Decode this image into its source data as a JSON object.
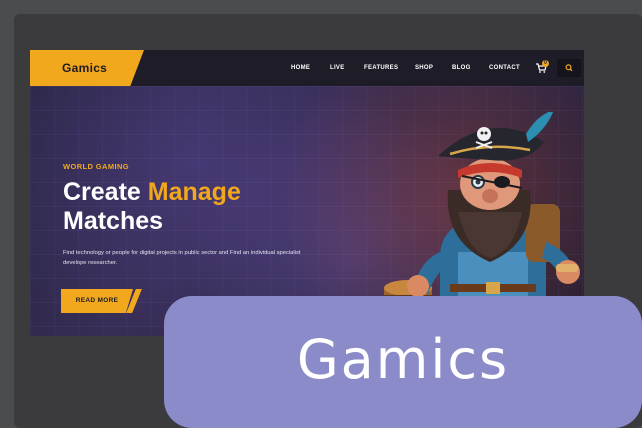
{
  "brand": {
    "name": "Gamics",
    "accent": "#f2a81d"
  },
  "nav": {
    "items": [
      "HOME",
      "LIVE",
      "FEATURES",
      "SHOP",
      "BLOG",
      "CONTACT"
    ],
    "cart_count": "0",
    "cart_icon": "cart-icon",
    "search_icon": "search-icon"
  },
  "hero": {
    "eyebrow": "WORLD GAMING",
    "title_part1": "Create ",
    "title_accent": "Manage",
    "title_part2": "Matches",
    "description": "Find technology or people for digital projects in public sector and Find an individual specialist develope researcher.",
    "cta_label": "READ MORE"
  },
  "overlay": {
    "label": "Gamics"
  }
}
